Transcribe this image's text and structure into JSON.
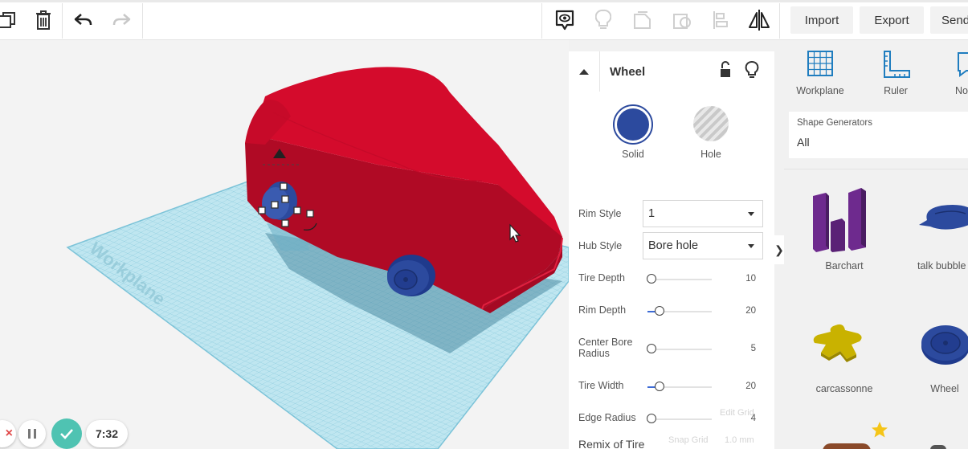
{
  "toolbar": {
    "import_label": "Import",
    "export_label": "Export",
    "send_label": "Send"
  },
  "viewport": {
    "workplane_watermark": "Workplane"
  },
  "inspector": {
    "title": "Wheel",
    "solid_label": "Solid",
    "hole_label": "Hole",
    "rim_style": {
      "label": "Rim Style",
      "value": "1"
    },
    "hub_style": {
      "label": "Hub Style",
      "value": "Bore hole"
    },
    "sliders": [
      {
        "label": "Tire Depth",
        "value": "10",
        "fraction": 0.0
      },
      {
        "label": "Rim Depth",
        "value": "20",
        "fraction": 0.12
      },
      {
        "label": "Center Bore Radius",
        "value": "5",
        "fraction": 0.0
      },
      {
        "label": "Tire Width",
        "value": "20",
        "fraction": 0.12
      },
      {
        "label": "Edge Radius",
        "value": "4",
        "fraction": 0.0
      }
    ],
    "remix_label": "Remix of Tire",
    "edit_grid_label": "Edit Grid",
    "snap_grid_label": "Snap Grid",
    "snap_grid_value": "1.0 mm"
  },
  "panel": {
    "workplane_label": "Workplane",
    "ruler_label": "Ruler",
    "notes_label": "No",
    "shape_generators_label": "Shape Generators",
    "shape_generators_value": "All",
    "shapes": [
      {
        "label": "Barchart"
      },
      {
        "label": "talk bubble"
      },
      {
        "label": "carcassonne"
      },
      {
        "label": "Wheel"
      }
    ]
  },
  "recorder": {
    "time": "7:32"
  },
  "colors": {
    "car_red": "#d40b2c",
    "workplane_blue": "#a9dcea",
    "solid_blue": "#2c4a9e",
    "accent_teal": "#4fc3b2"
  }
}
